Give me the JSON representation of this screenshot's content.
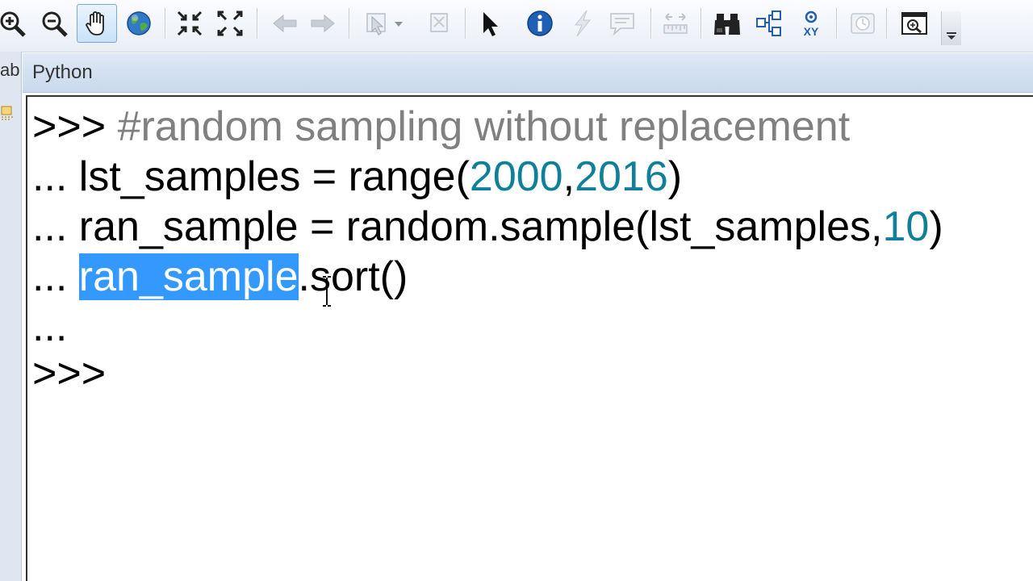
{
  "toolbar": {
    "buttons": [
      {
        "name": "zoom-in-icon"
      },
      {
        "name": "zoom-out-icon"
      },
      {
        "name": "pan-hand-icon",
        "active": true
      },
      {
        "name": "full-extent-globe-icon"
      },
      {
        "name": "fixed-zoom-in-icon"
      },
      {
        "name": "fixed-zoom-out-icon"
      },
      {
        "name": "back-arrow-icon",
        "disabled": true
      },
      {
        "name": "forward-arrow-icon",
        "disabled": true
      },
      {
        "name": "select-features-icon",
        "disabled": true
      },
      {
        "name": "clear-selection-icon",
        "disabled": true
      },
      {
        "name": "select-elements-pointer-icon"
      },
      {
        "name": "identify-info-icon"
      },
      {
        "name": "hyperlink-bolt-icon",
        "disabled": true
      },
      {
        "name": "html-popup-icon",
        "disabled": true
      },
      {
        "name": "measure-icon",
        "disabled": true
      },
      {
        "name": "find-binoculars-icon"
      },
      {
        "name": "find-route-icon"
      },
      {
        "name": "go-to-xy-icon",
        "label": "XY"
      },
      {
        "name": "time-slider-icon",
        "disabled": true
      },
      {
        "name": "magnifier-window-icon"
      }
    ]
  },
  "left_panel": {
    "tab_label": "ab"
  },
  "python_window": {
    "title": "Python",
    "lines": [
      {
        "prompt": ">>> ",
        "segments": [
          {
            "t": "#random sampling without replacement",
            "c": "comment"
          }
        ]
      },
      {
        "prompt": "... ",
        "segments": [
          {
            "t": "lst_samples = range(",
            "c": "code"
          },
          {
            "t": "2000",
            "c": "num"
          },
          {
            "t": ",",
            "c": "code"
          },
          {
            "t": "2016",
            "c": "num"
          },
          {
            "t": ")",
            "c": "code"
          }
        ]
      },
      {
        "prompt": "... ",
        "segments": [
          {
            "t": "ran_sample = random.sample(lst_samples,",
            "c": "code"
          },
          {
            "t": "10",
            "c": "num"
          },
          {
            "t": ")",
            "c": "code"
          }
        ]
      },
      {
        "prompt": "... ",
        "segments": [
          {
            "t": "ran_sample",
            "c": "sel"
          },
          {
            "t": ".sort()",
            "c": "code"
          }
        ]
      },
      {
        "prompt": "...",
        "segments": []
      },
      {
        "prompt": ">>>",
        "segments": []
      }
    ]
  },
  "colors": {
    "number": "#0f7f9a",
    "comment": "#808080",
    "selection": "#3399ff"
  }
}
